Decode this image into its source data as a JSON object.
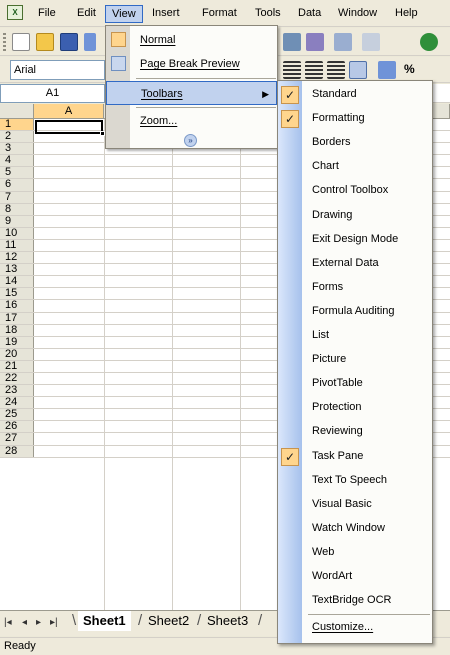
{
  "menubar": {
    "app_icon": "excel-icon",
    "items": [
      "File",
      "Edit",
      "View",
      "Insert",
      "Format",
      "Tools",
      "Data",
      "Window",
      "Help"
    ],
    "active": "View"
  },
  "formatting_toolbar": {
    "font": "Arial",
    "percent_symbol": "%"
  },
  "name_box": {
    "value": "A1"
  },
  "columns": [
    "A"
  ],
  "rows": [
    "1",
    "2",
    "3",
    "4",
    "5",
    "6",
    "7",
    "8",
    "9",
    "10",
    "11",
    "12",
    "13",
    "14",
    "15",
    "16",
    "17",
    "18",
    "19",
    "20",
    "21",
    "22",
    "23",
    "24",
    "25",
    "26",
    "27",
    "28"
  ],
  "view_menu": {
    "items": [
      {
        "label": "Normal",
        "icon": "normal-view-icon"
      },
      {
        "label": "Page Break Preview",
        "icon": "page-break-preview-icon"
      },
      {
        "label": "Toolbars",
        "has_submenu": true
      },
      {
        "label": "Zoom..."
      }
    ],
    "expand_icon": "double-chevron-down-icon"
  },
  "toolbars_menu": {
    "items": [
      {
        "label": "Standard",
        "checked": true
      },
      {
        "label": "Formatting",
        "checked": true
      },
      {
        "label": "Borders",
        "checked": false
      },
      {
        "label": "Chart",
        "checked": false
      },
      {
        "label": "Control Toolbox",
        "checked": false
      },
      {
        "label": "Drawing",
        "checked": false
      },
      {
        "label": "Exit Design Mode",
        "checked": false
      },
      {
        "label": "External Data",
        "checked": false
      },
      {
        "label": "Forms",
        "checked": false
      },
      {
        "label": "Formula Auditing",
        "checked": false
      },
      {
        "label": "List",
        "checked": false
      },
      {
        "label": "Picture",
        "checked": false
      },
      {
        "label": "PivotTable",
        "checked": false
      },
      {
        "label": "Protection",
        "checked": false
      },
      {
        "label": "Reviewing",
        "checked": false
      },
      {
        "label": "Task Pane",
        "checked": true
      },
      {
        "label": "Text To Speech",
        "checked": false
      },
      {
        "label": "Visual Basic",
        "checked": false
      },
      {
        "label": "Watch Window",
        "checked": false
      },
      {
        "label": "Web",
        "checked": false
      },
      {
        "label": "WordArt",
        "checked": false
      },
      {
        "label": "TextBridge OCR",
        "checked": false
      },
      {
        "label": "Customize...",
        "checked": false
      }
    ]
  },
  "sheet_tabs": [
    "Sheet1",
    "Sheet2",
    "Sheet3"
  ],
  "active_sheet": "Sheet1",
  "status": "Ready",
  "colors": {
    "highlight": "#c1d2ee",
    "check_bg": "#ffd58d",
    "menu_bg": "#fcfcf9"
  }
}
